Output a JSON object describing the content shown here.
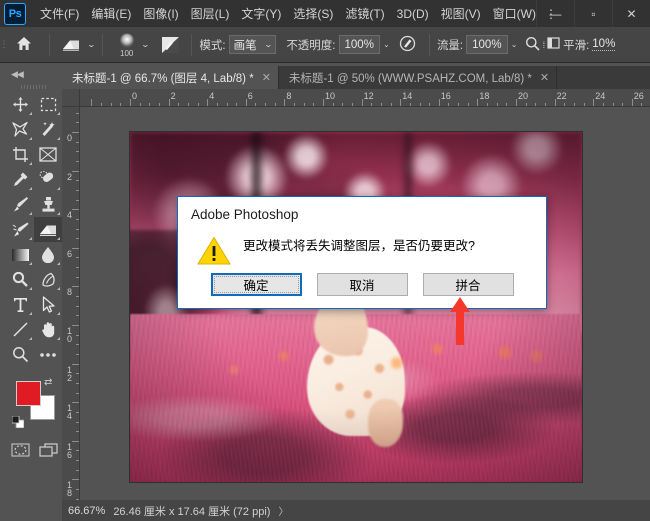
{
  "app": {
    "name": "Adobe Photoshop",
    "logo_text": "Ps"
  },
  "menubar": {
    "items": [
      {
        "label": "文件(F)",
        "name": "menu-file"
      },
      {
        "label": "编辑(E)",
        "name": "menu-edit"
      },
      {
        "label": "图像(I)",
        "name": "menu-image"
      },
      {
        "label": "图层(L)",
        "name": "menu-layer"
      },
      {
        "label": "文字(Y)",
        "name": "menu-type"
      },
      {
        "label": "选择(S)",
        "name": "menu-select"
      },
      {
        "label": "滤镜(T)",
        "name": "menu-filter"
      },
      {
        "label": "3D(D)",
        "name": "menu-3d"
      },
      {
        "label": "视图(V)",
        "name": "menu-view"
      },
      {
        "label": "窗口(W)",
        "name": "menu-window"
      }
    ],
    "overflow_label": "⋮",
    "window_controls": {
      "minimize": "—",
      "maximize": "▫",
      "close": "✕"
    }
  },
  "options_bar": {
    "home_icon": "home-icon",
    "tool_icon": "eraser-icon",
    "brush_size": "100",
    "brush_preset_icon": "brush-preset-icon",
    "mode_label": "模式:",
    "mode_value": "画笔",
    "opacity_label": "不透明度:",
    "opacity_value": "100%",
    "airbrush_icon": "airbrush-icon",
    "flow_label": "流量:",
    "flow_value": "100%",
    "tablet_pressure_icon": "tablet-pressure-icon",
    "smoothing_label": "平滑:",
    "smoothing_value": "10%"
  },
  "toolbox": {
    "collapse_label": "◀◀",
    "tools": [
      {
        "name": "move-tool",
        "icon": "move-icon",
        "has_submenu": true
      },
      {
        "name": "rectangular-marquee-tool",
        "icon": "marquee-icon",
        "has_submenu": true
      },
      {
        "name": "lasso-tool",
        "icon": "lasso-icon",
        "has_submenu": true
      },
      {
        "name": "magic-wand-tool",
        "icon": "magic-wand-icon",
        "has_submenu": true
      },
      {
        "name": "crop-tool",
        "icon": "crop-icon",
        "has_submenu": true
      },
      {
        "name": "frame-tool",
        "icon": "frame-icon",
        "has_submenu": false
      },
      {
        "name": "eyedropper-tool",
        "icon": "eyedropper-icon",
        "has_submenu": true
      },
      {
        "name": "healing-brush-tool",
        "icon": "healing-brush-icon",
        "has_submenu": true
      },
      {
        "name": "brush-tool",
        "icon": "brush-icon",
        "has_submenu": true
      },
      {
        "name": "clone-stamp-tool",
        "icon": "clone-stamp-icon",
        "has_submenu": true
      },
      {
        "name": "history-brush-tool",
        "icon": "history-brush-icon",
        "has_submenu": true
      },
      {
        "name": "eraser-tool",
        "icon": "eraser-icon",
        "has_submenu": true,
        "active": true
      },
      {
        "name": "gradient-tool",
        "icon": "gradient-icon",
        "has_submenu": true
      },
      {
        "name": "blur-tool",
        "icon": "blur-drop-icon",
        "has_submenu": true
      },
      {
        "name": "dodge-tool",
        "icon": "dodge-icon",
        "has_submenu": true
      },
      {
        "name": "pen-tool",
        "icon": "pen-icon",
        "has_submenu": true
      },
      {
        "name": "type-tool",
        "icon": "type-icon",
        "has_submenu": true
      },
      {
        "name": "path-selection-tool",
        "icon": "path-arrow-icon",
        "has_submenu": true
      },
      {
        "name": "line-tool",
        "icon": "line-shape-icon",
        "has_submenu": true
      },
      {
        "name": "hand-tool",
        "icon": "hand-icon",
        "has_submenu": true
      },
      {
        "name": "zoom-tool",
        "icon": "magnifier-icon",
        "has_submenu": false
      },
      {
        "name": "edit-toolbar-tool",
        "icon": "ellipsis-icon",
        "has_submenu": false
      }
    ],
    "foreground_color": "#e01b24",
    "background_color": "#ffffff",
    "swap_icon": "swap-colors-icon",
    "default_colors_icon": "default-colors-icon",
    "quickmask_icon": "quick-mask-icon",
    "screenmode_icon": "screen-mode-icon"
  },
  "tabs": [
    {
      "label": "未标题-1 @ 66.7% (图层 4, Lab/8) *",
      "close": "✕",
      "active": true,
      "name": "tab-untitled-1-66"
    },
    {
      "label": "未标题-1 @ 50% (WWW.PSAHZ.COM, Lab/8) *",
      "close": "✕",
      "active": false,
      "name": "tab-untitled-1-50"
    }
  ],
  "rulers": {
    "unit": "厘米",
    "horizontal_labels": [
      "0",
      "2",
      "4",
      "6",
      "8",
      "10",
      "12",
      "14",
      "16",
      "18",
      "20",
      "22",
      "24",
      "26"
    ],
    "vertical_labels": [
      "0",
      "2",
      "4",
      "6",
      "8",
      "10",
      "12",
      "14",
      "16",
      "18"
    ]
  },
  "dialog": {
    "title": "Adobe Photoshop",
    "icon": "warning-triangle-icon",
    "message": "更改模式将丢失调整图层，是否仍要更改?",
    "buttons": [
      {
        "label": "确定",
        "name": "ok-button",
        "default": true
      },
      {
        "label": "取消",
        "name": "cancel-button",
        "default": false
      },
      {
        "label": "拼合",
        "name": "flatten-button",
        "default": false
      }
    ],
    "accent_color": "#0f6cbd",
    "warning_color": "#ffd400"
  },
  "annotation": {
    "arrow_color": "#f5372c",
    "arrow_target": "flatten-button"
  },
  "statusbar": {
    "zoom": "66.67%",
    "dimensions": "26.46 厘米 x 17.64 厘米 (72 ppi)",
    "expand_arrow": "〉"
  }
}
